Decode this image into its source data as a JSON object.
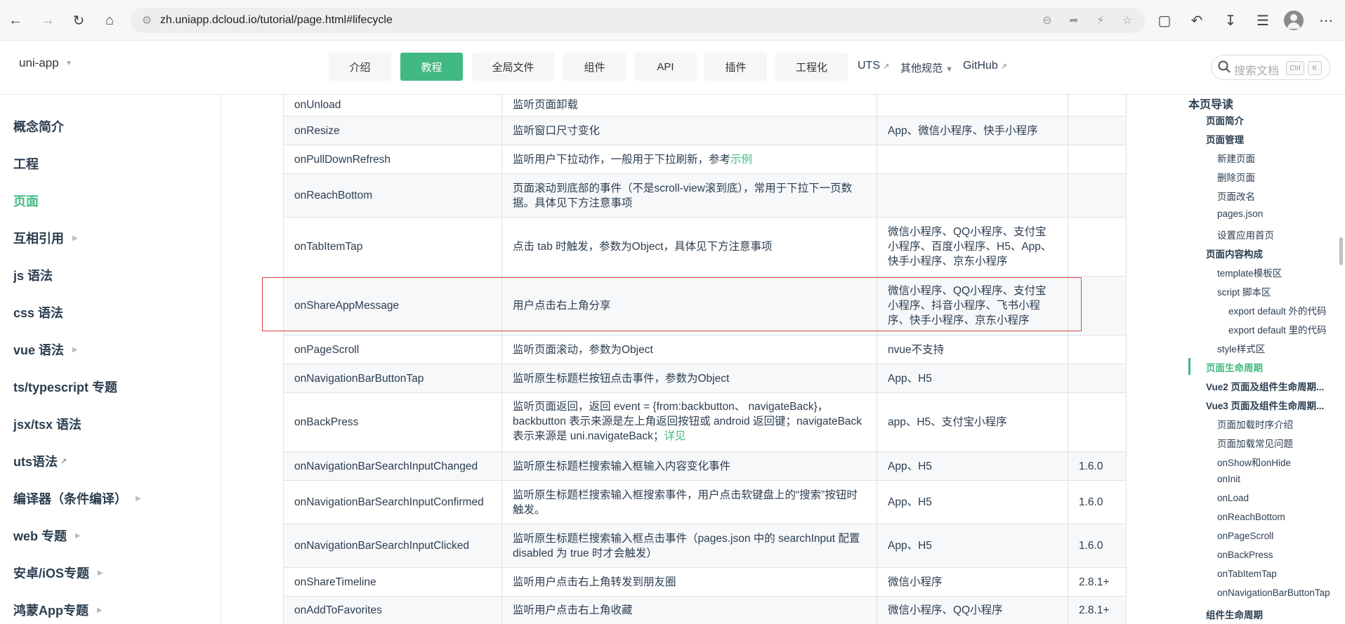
{
  "browser": {
    "url": "zh.uniapp.dcloud.io/tutorial/page.html#lifecycle"
  },
  "header": {
    "logo": "uni-app",
    "nav": [
      {
        "label": "介绍"
      },
      {
        "label": "教程"
      },
      {
        "label": "全局文件"
      },
      {
        "label": "组件"
      },
      {
        "label": "API"
      },
      {
        "label": "插件"
      },
      {
        "label": "工程化"
      }
    ],
    "links": {
      "uts": "UTS",
      "other": "其他规范",
      "github": "GitHub"
    },
    "search_placeholder": "搜索文档",
    "kbd_ctrl": "Ctrl",
    "kbd_k": "K",
    "active_nav": "教程"
  },
  "sidebar": {
    "items": [
      {
        "label": "概念简介"
      },
      {
        "label": "工程"
      },
      {
        "label": "页面"
      },
      {
        "label": "互相引用"
      },
      {
        "label": "js 语法"
      },
      {
        "label": "css 语法"
      },
      {
        "label": "vue 语法"
      },
      {
        "label": "ts/typescript 专题"
      },
      {
        "label": "jsx/tsx 语法"
      },
      {
        "label": "uts语法"
      },
      {
        "label": "编译器（条件编译）"
      },
      {
        "label": "web 专题"
      },
      {
        "label": "安卓/iOS专题"
      },
      {
        "label": "鸿蒙App专题"
      }
    ],
    "active": "页面"
  },
  "table": {
    "rows": [
      {
        "name": "onUnload",
        "desc": "监听页面卸载",
        "platform": "",
        "version": ""
      },
      {
        "name": "onResize",
        "desc": "监听窗口尺寸变化",
        "platform": "App、微信小程序、快手小程序",
        "version": ""
      },
      {
        "name": "onPullDownRefresh",
        "desc": "监听用户下拉动作，一般用于下拉刷新，参考",
        "desc_link": "示例",
        "platform": "",
        "version": ""
      },
      {
        "name": "onReachBottom",
        "desc": "页面滚动到底部的事件（不是scroll-view滚到底），常用于下拉下一页数据。具体见下方注意事项",
        "platform": "",
        "version": ""
      },
      {
        "name": "onTabItemTap",
        "desc": "点击 tab 时触发，参数为Object，具体见下方注意事项",
        "platform": "微信小程序、QQ小程序、支付宝小程序、百度小程序、H5、App、快手小程序、京东小程序",
        "version": ""
      },
      {
        "name": "onShareAppMessage",
        "desc": "用户点击右上角分享",
        "platform": "微信小程序、QQ小程序、支付宝小程序、抖音小程序、飞书小程序、快手小程序、京东小程序",
        "version": ""
      },
      {
        "name": "onPageScroll",
        "desc": "监听页面滚动，参数为Object",
        "platform": "nvue不支持",
        "version": ""
      },
      {
        "name": "onNavigationBarButtonTap",
        "desc": "监听原生标题栏按钮点击事件，参数为Object",
        "platform": "App、H5",
        "version": ""
      },
      {
        "name": "onBackPress",
        "desc": "监听页面返回，返回 event = {from:backbutton、 navigateBack}，backbutton 表示来源是左上角返回按钮或 android 返回键；navigateBack表示来源是 uni.navigateBack；",
        "desc_link": "详见",
        "platform": "app、H5、支付宝小程序",
        "version": ""
      },
      {
        "name": "onNavigationBarSearchInputChanged",
        "desc": "监听原生标题栏搜索输入框输入内容变化事件",
        "platform": "App、H5",
        "version": "1.6.0"
      },
      {
        "name": "onNavigationBarSearchInputConfirmed",
        "desc": "监听原生标题栏搜索输入框搜索事件，用户点击软键盘上的“搜索”按钮时触发。",
        "platform": "App、H5",
        "version": "1.6.0"
      },
      {
        "name": "onNavigationBarSearchInputClicked",
        "desc": "监听原生标题栏搜索输入框点击事件（pages.json 中的 searchInput 配置 disabled 为 true 时才会触发）",
        "platform": "App、H5",
        "version": "1.6.0"
      },
      {
        "name": "onShareTimeline",
        "desc": "监听用户点击右上角转发到朋友圈",
        "platform": "微信小程序",
        "version": "2.8.1+"
      },
      {
        "name": "onAddToFavorites",
        "desc": "监听用户点击右上角收藏",
        "platform": "微信小程序、QQ小程序",
        "version": "2.8.1+"
      }
    ]
  },
  "toc": {
    "title": "本页导读",
    "items": [
      {
        "label": "页面简介"
      },
      {
        "label": "页面管理"
      },
      {
        "label": "新建页面"
      },
      {
        "label": "删除页面"
      },
      {
        "label": "页面改名"
      },
      {
        "label": "pages.json"
      },
      {
        "label": "设置应用首页"
      },
      {
        "label": "页面内容构成"
      },
      {
        "label": "template模板区"
      },
      {
        "label": "script 脚本区"
      },
      {
        "label": "export default 外的代码"
      },
      {
        "label": "export default 里的代码"
      },
      {
        "label": "style样式区"
      },
      {
        "label": "页面生命周期"
      },
      {
        "label": "Vue2 页面及组件生命周期..."
      },
      {
        "label": "Vue3 页面及组件生命周期..."
      },
      {
        "label": "页面加载时序介绍"
      },
      {
        "label": "页面加载常见问题"
      },
      {
        "label": "onShow和onHide"
      },
      {
        "label": "onInit"
      },
      {
        "label": "onLoad"
      },
      {
        "label": "onReachBottom"
      },
      {
        "label": "onPageScroll"
      },
      {
        "label": "onBackPress"
      },
      {
        "label": "onTabItemTap"
      },
      {
        "label": "onNavigationBarButtonTap"
      },
      {
        "label": "组件生命周期"
      }
    ],
    "active": "页面生命周期"
  },
  "colors": {
    "accent": "#42b983",
    "highlight": "#e0433e"
  }
}
